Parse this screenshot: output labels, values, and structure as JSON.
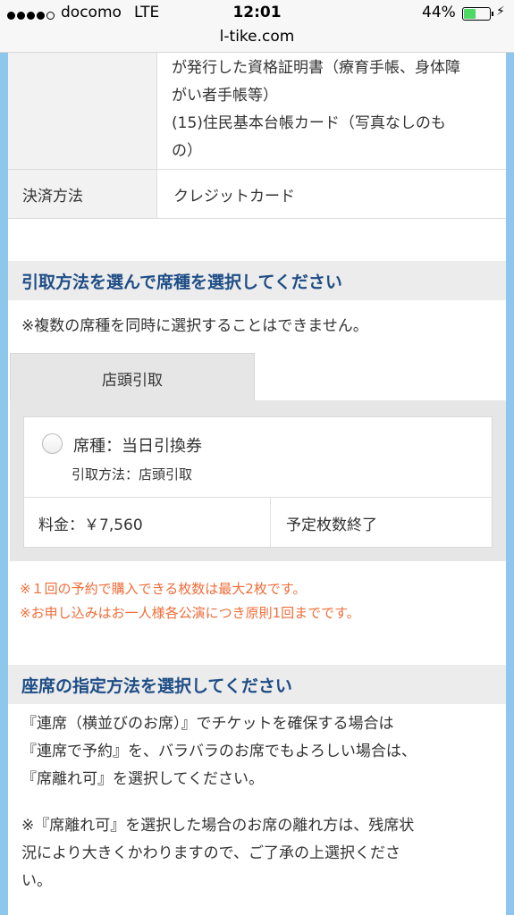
{
  "status_bar": {
    "carrier": "docomo",
    "network": "LTE",
    "time": "12:01",
    "battery_percent": "44%",
    "battery_level": 0.44
  },
  "browser": {
    "url": "l-tike.com"
  },
  "info_table": {
    "continued_lines": [
      "が発行した資格証明書（療育手帳、身体障",
      "がい者手帳等）",
      "(15)住民基本台帳カード（写真なしのも",
      "の）"
    ],
    "payment_label": "決済方法",
    "payment_value": "クレジットカード"
  },
  "pickup_section": {
    "title": "引取方法を選んで席種を選択してください",
    "note": "※複数の席種を同時に選択することはできません。",
    "tab_label": "店頭引取",
    "seat_option": {
      "seat_type": "席種：当日引換券",
      "pickup_method": "引取方法：店頭引取",
      "price": "料金：￥7,560",
      "availability": "予定枚数終了"
    },
    "warnings": [
      "※１回の予約で購入できる枚数は最大2枚です。",
      "※お申し込みはお一人様各公演につき原則1回までです。"
    ]
  },
  "seat_method_section": {
    "title": "座席の指定方法を選択してください",
    "paragraph1_lines": [
      "『連席（横並びのお席）』でチケットを確保する場合は",
      "『連席で予約』を、バラバラのお席でもよろしい場合は、",
      "『席離れ可』を選択してください。"
    ],
    "paragraph2_lines": [
      "※『席離れ可』を選択した場合のお席の離れ方は、残席状",
      "況により大きくかわりますので、ご了承の上選択くださ",
      "い。"
    ]
  },
  "colors": {
    "frame": "#8fc6ec",
    "section_title": "#1e4d86",
    "warning": "#ef6d3a",
    "battery": "#4cd964"
  }
}
